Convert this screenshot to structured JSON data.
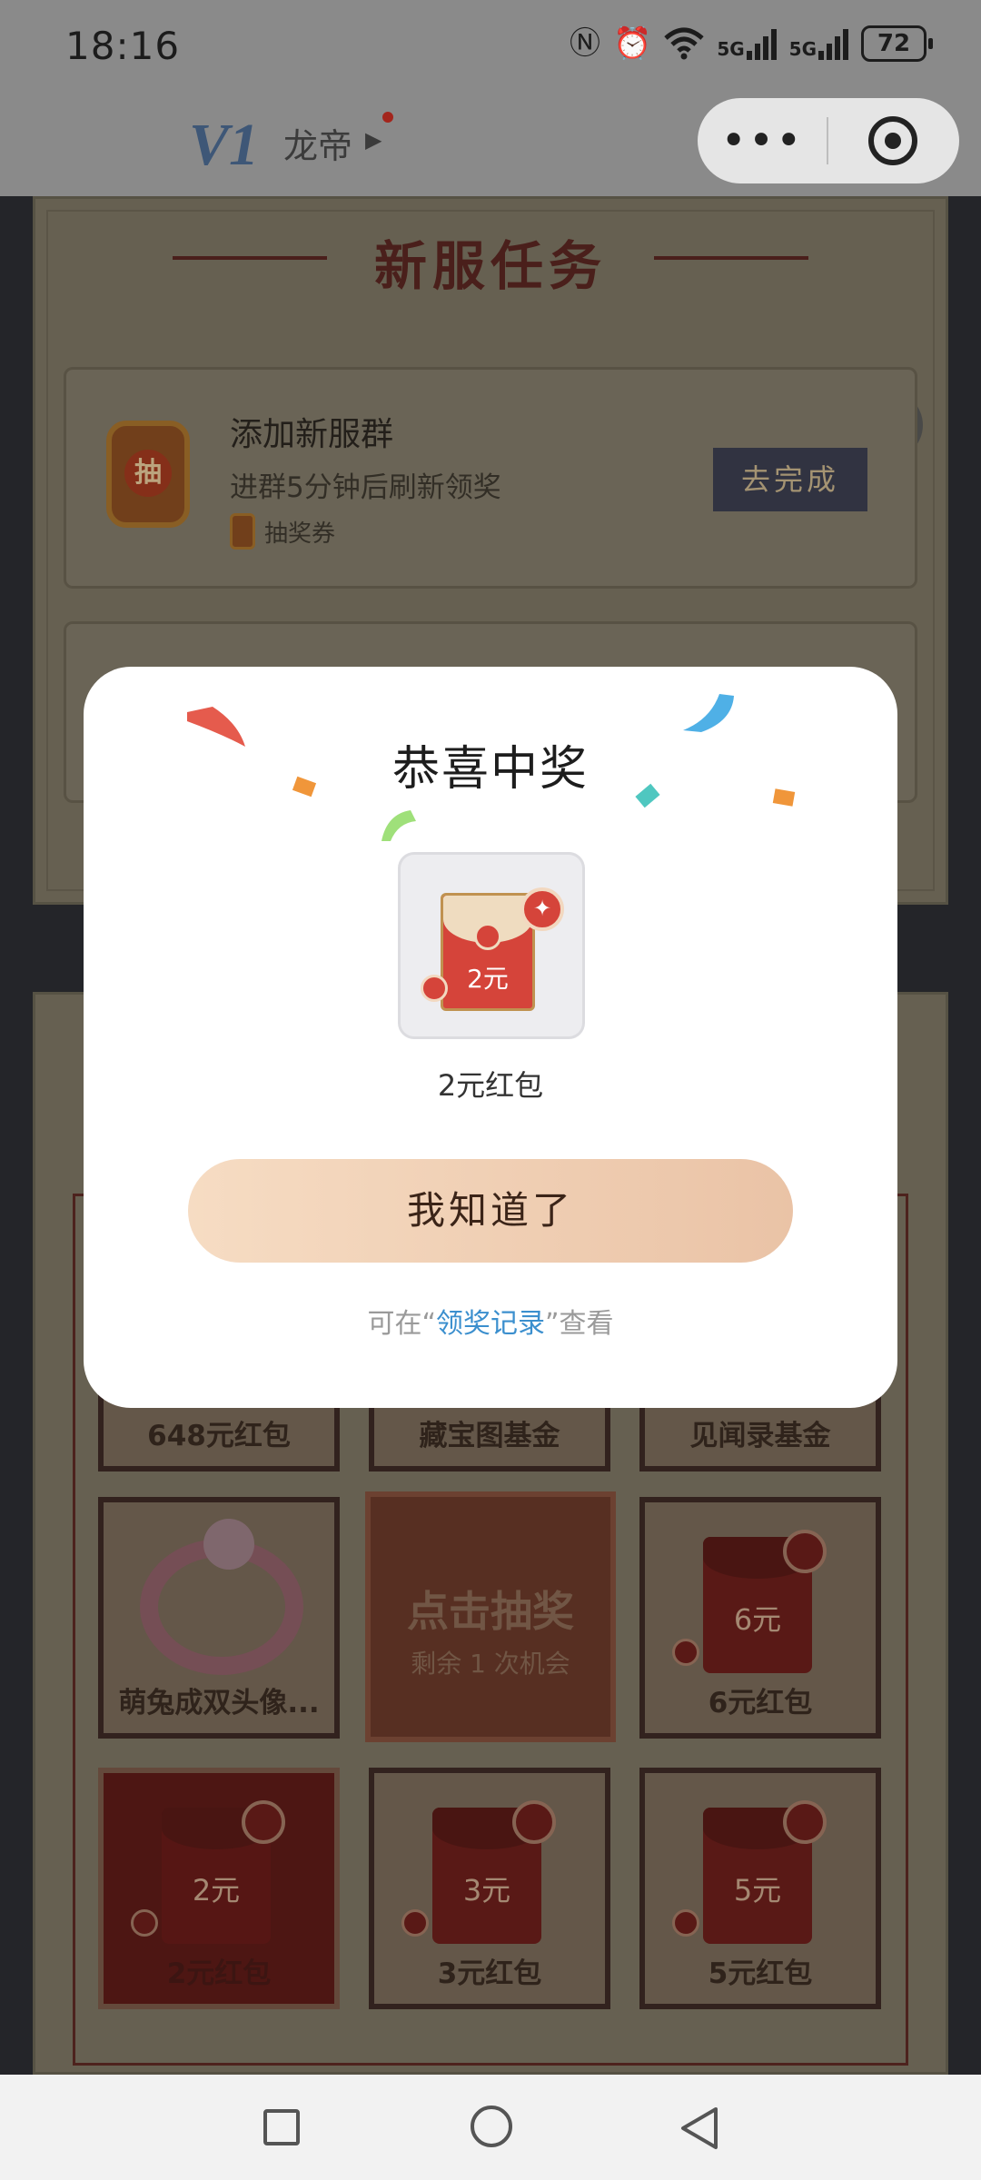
{
  "status_bar": {
    "time": "18:16",
    "network_1": "5G",
    "network_2": "5G",
    "battery": "72"
  },
  "nav_bar": {
    "logo": "V1",
    "title": "龙帝"
  },
  "task_panel": {
    "title": "新服任务",
    "task": {
      "name": "添加新服群",
      "desc": "进群5分钟后刷新领奖",
      "reward": "抽奖券",
      "button": "去完成",
      "icon_char": "抽"
    }
  },
  "lottery": {
    "row1": [
      "648元红包",
      "藏宝图基金",
      "见闻录基金"
    ],
    "cell_bracelet": "萌兔成双头像...",
    "center": {
      "title": "点击抽奖",
      "sub": "剩余 1 次机会"
    },
    "cell_6": {
      "amount": "6元",
      "label": "6元红包"
    },
    "cell_2": {
      "amount": "2元",
      "label": "2元红包"
    },
    "cell_3": {
      "amount": "3元",
      "label": "3元红包"
    },
    "cell_5": {
      "amount": "5元",
      "label": "5元红包"
    }
  },
  "modal": {
    "title": "恭喜中奖",
    "prize_amount": "2元",
    "prize_name": "2元红包",
    "ok_button": "我知道了",
    "footnote_prefix": "可在“",
    "footnote_link": "领奖记录",
    "footnote_suffix": "”查看"
  },
  "colors": {
    "accent_link": "#3b8fce",
    "button_gradient_start": "#f6dcc3",
    "button_gradient_end": "#eac3a6",
    "envelope_red": "#d5443a"
  },
  "icons": [
    "nfc-icon",
    "alarm-icon",
    "wifi-icon",
    "signal-icon",
    "battery-icon",
    "more-dots-icon",
    "close-target-icon",
    "refresh-icon",
    "red-envelope-icon",
    "square-nav-icon",
    "circle-nav-icon",
    "back-triangle-icon"
  ]
}
